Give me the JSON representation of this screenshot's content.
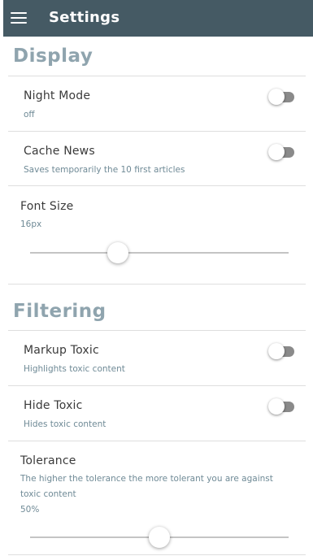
{
  "app": {
    "title": "Settings",
    "menu_icon": "hamburger-menu-icon"
  },
  "colors": {
    "appbar": "#455a64",
    "section_title": "#8fa4ae",
    "subtitle": "#6f8a96",
    "toggle_track": "#8a8a8a"
  },
  "display": {
    "title": "Display",
    "night_mode": {
      "label": "Night Mode",
      "subtitle": "off",
      "on": false
    },
    "cache_news": {
      "label": "Cache News",
      "subtitle": "Saves temporarily the 10 first articles",
      "on": false
    },
    "font_size": {
      "label": "Font Size",
      "value": "16px",
      "slider_fraction": 0.34
    }
  },
  "filtering": {
    "title": "Filtering",
    "markup_toxic": {
      "label": "Markup Toxic",
      "subtitle": "Highlights toxic content",
      "on": false
    },
    "hide_toxic": {
      "label": "Hide Toxic",
      "subtitle": "Hides toxic content",
      "on": false
    },
    "tolerance": {
      "label": "Tolerance",
      "description_line1": "The higher the tolerance the more tolerant you are against",
      "description_line2": "toxic content",
      "value": "50%",
      "slider_fraction": 0.5
    }
  }
}
